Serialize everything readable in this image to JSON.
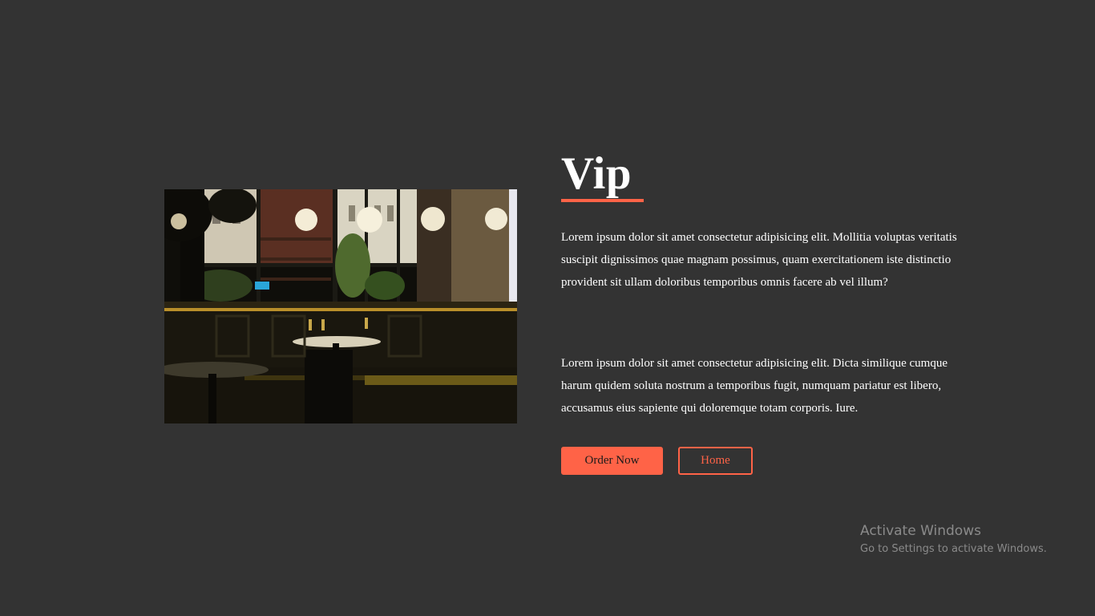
{
  "hero": {
    "title": "Vip",
    "paragraph_1": "Lorem ipsum dolor sit amet consectetur adipisicing elit. Mollitia voluptas veritatis suscipit dignissimos quae magnam possimus, quam exercitationem iste distinctio provident sit ullam doloribus temporibus omnis facere ab vel illum?",
    "paragraph_2": "Lorem ipsum dolor sit amet consectetur adipisicing elit. Dicta similique cumque harum quidem soluta nostrum a temporibus fugit, numquam pariatur est libero, accusamus eius sapiente qui doloremque totam corporis. Iure.",
    "image": {
      "icon": "restaurant-interior-photo"
    },
    "buttons": {
      "order_label": "Order Now",
      "home_label": "Home"
    }
  },
  "watermark": {
    "title": "Activate Windows",
    "subtitle": "Go to Settings to activate Windows."
  },
  "colors": {
    "background": "#333333",
    "accent": "#ff6347",
    "text": "#ffffff"
  }
}
